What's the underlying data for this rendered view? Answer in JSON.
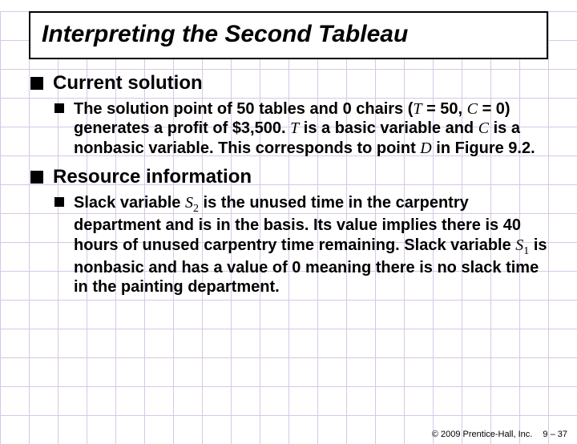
{
  "title": "Interpreting the Second Tableau",
  "bullets": {
    "b1_label": "Current solution",
    "b1_sub_pre": "The solution point of 50 tables and 0 chairs (",
    "b1_var_T": "T",
    "b1_eq1": " = 50, ",
    "b1_var_C": "C",
    "b1_eq2": " = 0) generates a profit of $3,500. ",
    "b1_var_T2": "T",
    "b1_mid": " is a basic variable and ",
    "b1_var_C2": "C",
    "b1_post": " is a nonbasic variable. This corresponds to point ",
    "b1_var_D": "D",
    "b1_end": " in Figure 9.2.",
    "b2_label": "Resource information",
    "b2_sub_pre": "Slack variable ",
    "b2_var_S2": "S",
    "b2_sub2": "2",
    "b2_mid": " is the unused time in the carpentry department and is in the basis. Its value implies there is 40 hours of unused carpentry time remaining. Slack variable ",
    "b2_var_S1": "S",
    "b2_sub1": "1",
    "b2_end": " is nonbasic and has a value of 0 meaning there is no slack time in the painting department."
  },
  "footer": {
    "copyright": "© 2009 Prentice-Hall, Inc.",
    "page": "9 – 37"
  }
}
